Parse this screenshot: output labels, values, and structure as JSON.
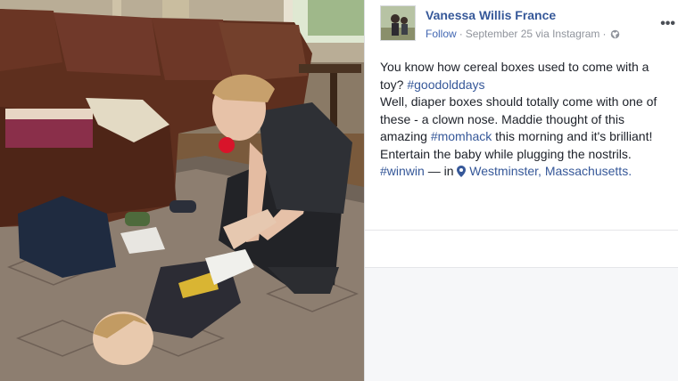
{
  "post": {
    "author": "Vanessa Willis France",
    "follow_label": "Follow",
    "separator": "·",
    "date": "September 25 via Instagram",
    "privacy_icon": "globe-icon",
    "more_label": "•••",
    "text_line1": "You know how cereal boxes used to come with a toy?",
    "tag1": "#goodolddays",
    "text_part2": "Well, diaper boxes should totally come with one of these - a clown nose. Maddie thought of this amazing",
    "tag2": "#momhack",
    "text_part3": "this morning and it's brilliant! Entertain the baby while plugging the nostrils.",
    "tag3": "#winwin",
    "in_text": "— in",
    "location_icon": "map-pin-icon",
    "location": "Westminster, Massachusetts."
  },
  "colors": {
    "link": "#365899",
    "meta": "#90949c",
    "text": "#1d2129"
  }
}
